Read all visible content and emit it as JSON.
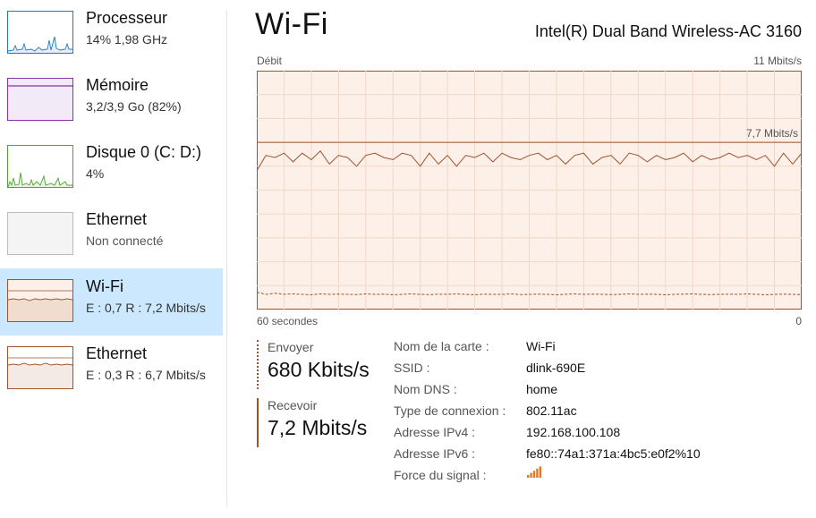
{
  "sidebar": {
    "items": [
      {
        "title": "Processeur",
        "subtitle": "14%  1,98 GHz",
        "thumb_color": "#1c7cc0",
        "thumb_fill": "#ffffff"
      },
      {
        "title": "Mémoire",
        "subtitle": "3,2/3,9 Go (82%)",
        "thumb_color": "#8b32a6",
        "thumb_fill": "#f3eaf7"
      },
      {
        "title": "Disque 0 (C: D:)",
        "subtitle": "4%",
        "thumb_color": "#4da52c",
        "thumb_fill": "#ffffff"
      },
      {
        "title": "Ethernet",
        "subtitle": "Non connecté",
        "thumb_color": "#bcbcbc",
        "thumb_fill": "#f4f4f4"
      },
      {
        "title": "Wi-Fi",
        "subtitle": "E : 0,7 R : 7,2 Mbits/s",
        "thumb_color": "#a0522d",
        "thumb_fill": "#fdf0e8",
        "selected": true
      },
      {
        "title": "Ethernet",
        "subtitle": "E : 0,3 R : 6,7 Mbits/s",
        "thumb_color": "#a0522d",
        "thumb_fill": "#ffffff"
      }
    ]
  },
  "main": {
    "title": "Wi-Fi",
    "adapter": "Intel(R) Dual Band Wireless-AC 3160"
  },
  "chart_data": {
    "type": "line",
    "title": "Débit",
    "y_max_label": "11 Mbits/s",
    "ref_label": "7,7 Mbits/s",
    "x_start_label": "60 secondes",
    "x_end_label": "0",
    "ylim": [
      0,
      11
    ],
    "xlim": [
      60,
      0
    ],
    "ref_line": 7.7,
    "grid": true,
    "colors": {
      "line": "#a0522d",
      "fill": "#fdf0e8",
      "grid": "#f0d8c8"
    },
    "series": [
      {
        "style": "solid",
        "values": [
          6.4,
          7.1,
          7.0,
          7.2,
          6.8,
          7.2,
          6.9,
          7.3,
          6.7,
          7.1,
          7.0,
          6.6,
          7.1,
          7.2,
          7.0,
          6.9,
          7.2,
          7.1,
          6.6,
          7.2,
          6.7,
          7.1,
          6.6,
          7.1,
          7.0,
          7.2,
          6.8,
          7.2,
          7.0,
          6.9,
          7.1,
          7.2,
          6.9,
          7.1,
          6.7,
          7.1,
          7.2,
          6.7,
          7.0,
          7.1,
          6.7,
          7.2,
          7.1,
          6.8,
          7.1,
          6.9,
          7.0,
          7.2,
          6.8,
          7.1,
          6.9,
          7.0,
          7.2,
          7.0,
          7.1,
          6.9,
          7.1,
          6.6,
          7.2,
          6.7,
          7.2
        ]
      },
      {
        "style": "dashed",
        "values": [
          0.8,
          0.7,
          0.75,
          0.7,
          0.72,
          0.7,
          0.68,
          0.72,
          0.7,
          0.71,
          0.7,
          0.69,
          0.72,
          0.7,
          0.71,
          0.68,
          0.7,
          0.72,
          0.7,
          0.69,
          0.71,
          0.7,
          0.72,
          0.7,
          0.68,
          0.71,
          0.7,
          0.7,
          0.72,
          0.69,
          0.7,
          0.71,
          0.7,
          0.68,
          0.7,
          0.72,
          0.7,
          0.71,
          0.7,
          0.69,
          0.7,
          0.72,
          0.7,
          0.71,
          0.7,
          0.68,
          0.7,
          0.71,
          0.72,
          0.7,
          0.69,
          0.7,
          0.71,
          0.7,
          0.72,
          0.7,
          0.68,
          0.7,
          0.71,
          0.7,
          0.69
        ]
      }
    ]
  },
  "stats": {
    "send_label": "Envoyer",
    "send_value": "680 Kbits/s",
    "recv_label": "Recevoir",
    "recv_value": "7,2 Mbits/s"
  },
  "info": {
    "rows": [
      {
        "key": "Nom de la carte :",
        "value": "Wi-Fi"
      },
      {
        "key": "SSID :",
        "value": "dlink-690E"
      },
      {
        "key": "Nom DNS :",
        "value": "home"
      },
      {
        "key": "Type de connexion :",
        "value": "802.11ac"
      },
      {
        "key": "Adresse IPv4 :",
        "value": "192.168.100.108"
      },
      {
        "key": "Adresse IPv6 :",
        "value": "fe80::74a1:371a:4bc5:e0f2%10"
      },
      {
        "key": "Force du signal :",
        "value": ""
      }
    ],
    "signal_icon": "signal-strength-icon",
    "signal_bars": 5,
    "signal_color": "#e07b1f"
  }
}
